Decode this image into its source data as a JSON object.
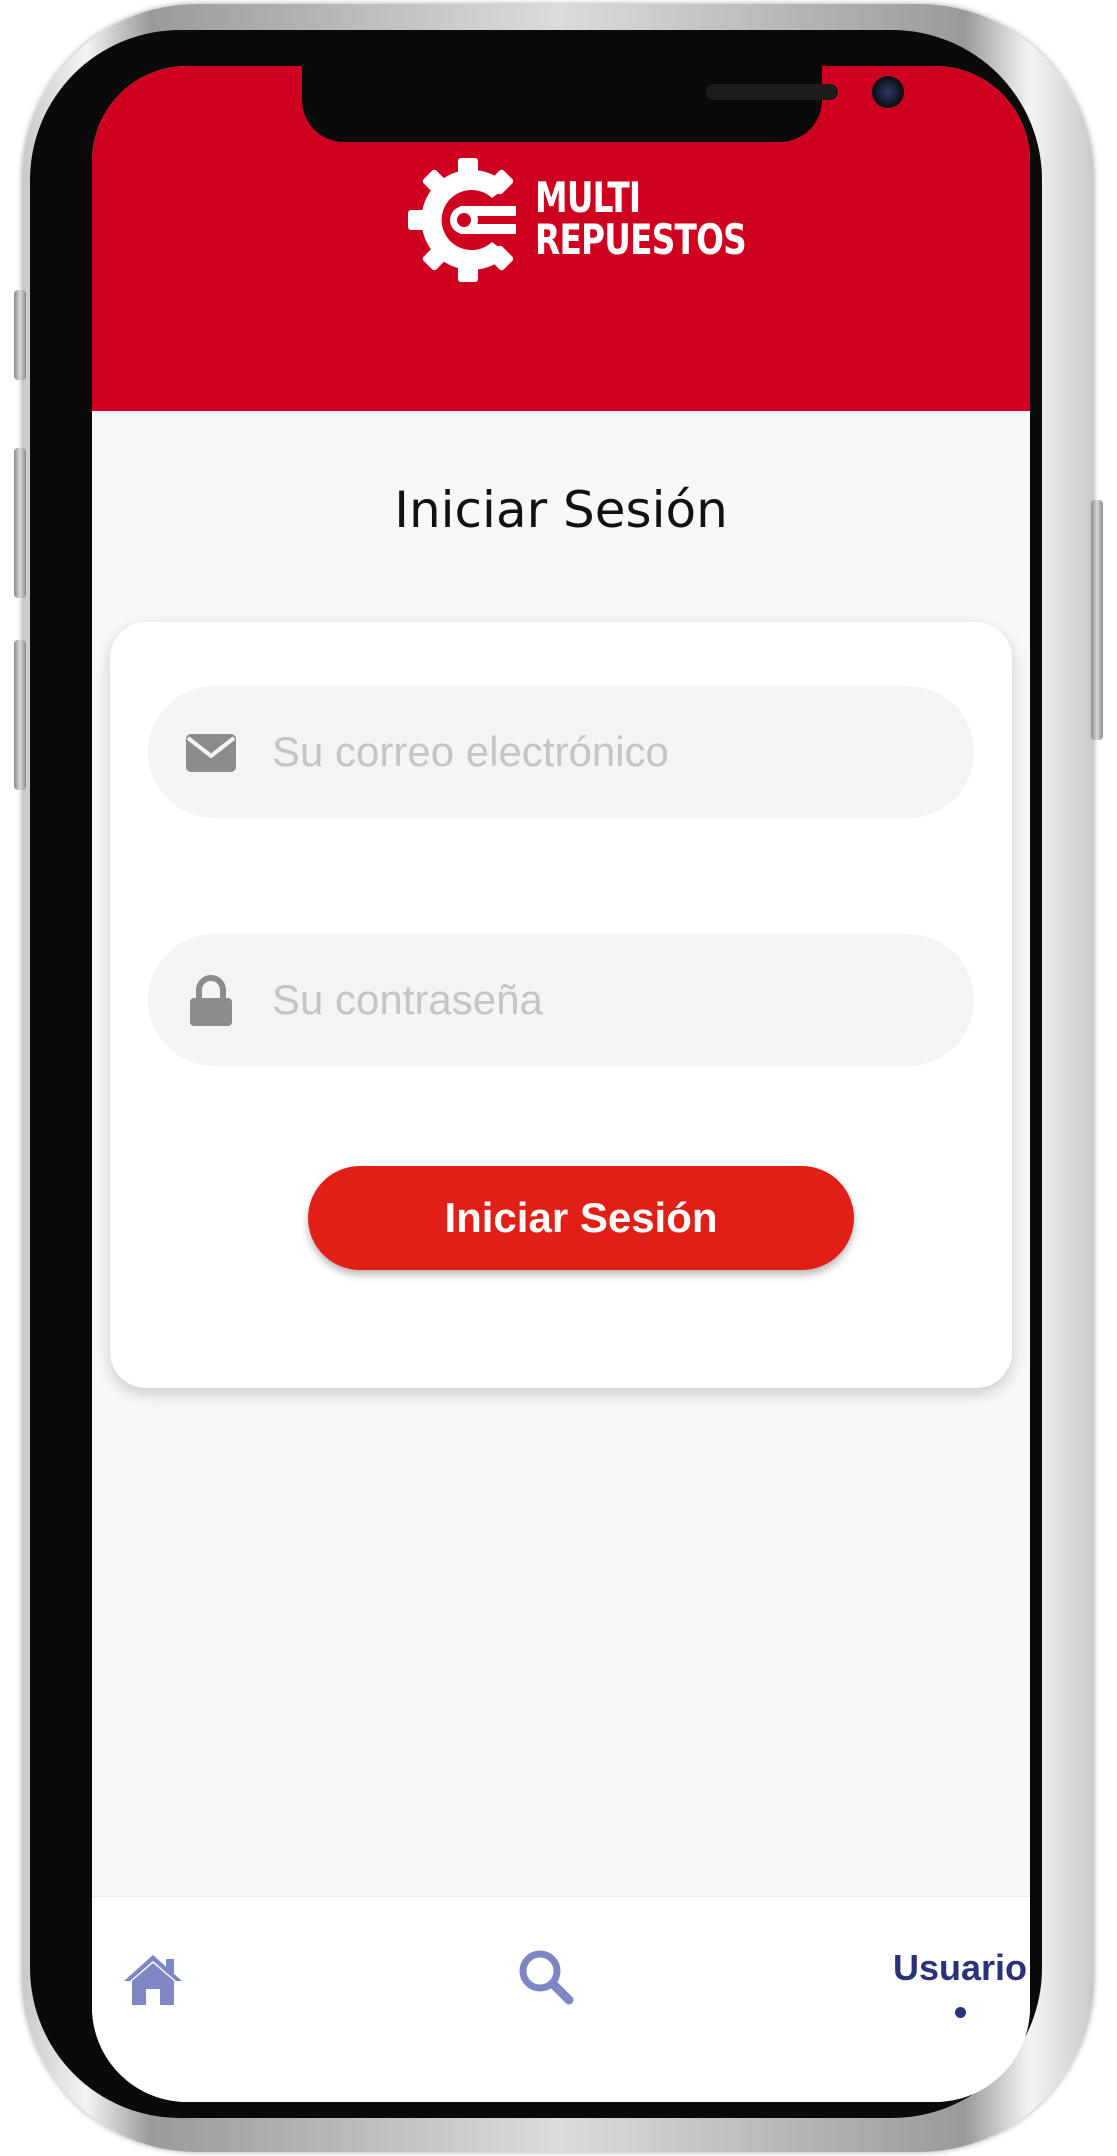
{
  "brand": {
    "line1": "MULTI",
    "line2": "REPUESTOS",
    "header_color": "#cf001f"
  },
  "page": {
    "title": "Iniciar Sesión"
  },
  "form": {
    "email": {
      "placeholder": "Su correo electrónico",
      "value": "",
      "icon": "envelope-icon"
    },
    "password": {
      "placeholder": "Su contraseña",
      "value": "",
      "icon": "lock-icon"
    },
    "submit_label": "Iniciar Sesión",
    "submit_color": "#e11f17"
  },
  "bottom_nav": {
    "items": [
      {
        "id": "home",
        "icon": "home-icon",
        "label": ""
      },
      {
        "id": "search",
        "icon": "search-icon",
        "label": ""
      },
      {
        "id": "user",
        "icon": "",
        "label": "Usuario",
        "active": true
      }
    ],
    "active_color": "#2a327a",
    "icon_color": "#7f86c4"
  }
}
